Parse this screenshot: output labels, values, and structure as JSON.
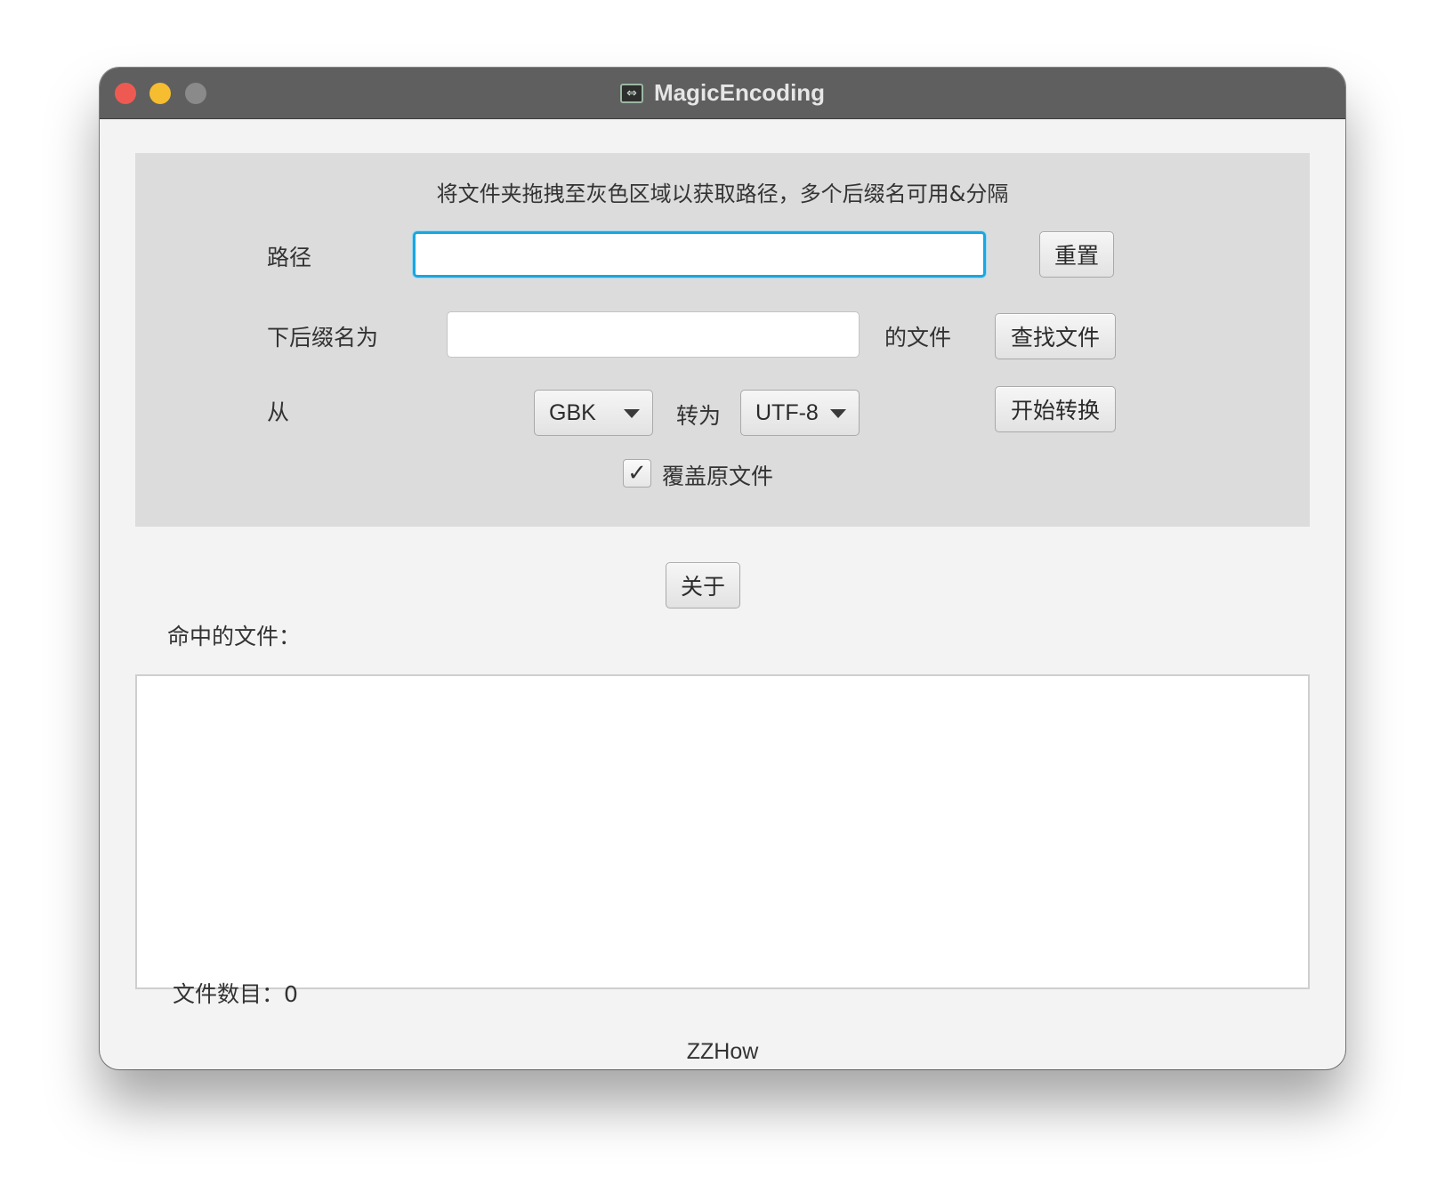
{
  "window": {
    "title": "MagicEncoding",
    "controls": {
      "close_color": "#ee5a52",
      "minimize_color": "#f5bd2f",
      "maximize_color": "#8a8a8a"
    }
  },
  "panel": {
    "hint": "将文件夹拖拽至灰色区域以获取路径，多个后缀名可用&分隔",
    "path_label": "路径",
    "path_value": "",
    "reset_button": "重置",
    "suffix_label": "下后缀名为",
    "suffix_value": "",
    "files_suffix_label": "的文件",
    "find_button": "查找文件",
    "from_label": "从",
    "from_encoding": "GBK",
    "to_label": "转为",
    "to_encoding": "UTF-8",
    "convert_button": "开始转换",
    "overwrite_label": "覆盖原文件",
    "overwrite_checked": true,
    "check_glyph": "✓"
  },
  "about_button": "关于",
  "matched_files_label": "命中的文件：",
  "matched_files": [],
  "file_count_label": "文件数目：0",
  "footer": "ZZHow",
  "colors": {
    "panel_bg": "#dcdcdc",
    "focus_ring": "#1aa6e0"
  }
}
